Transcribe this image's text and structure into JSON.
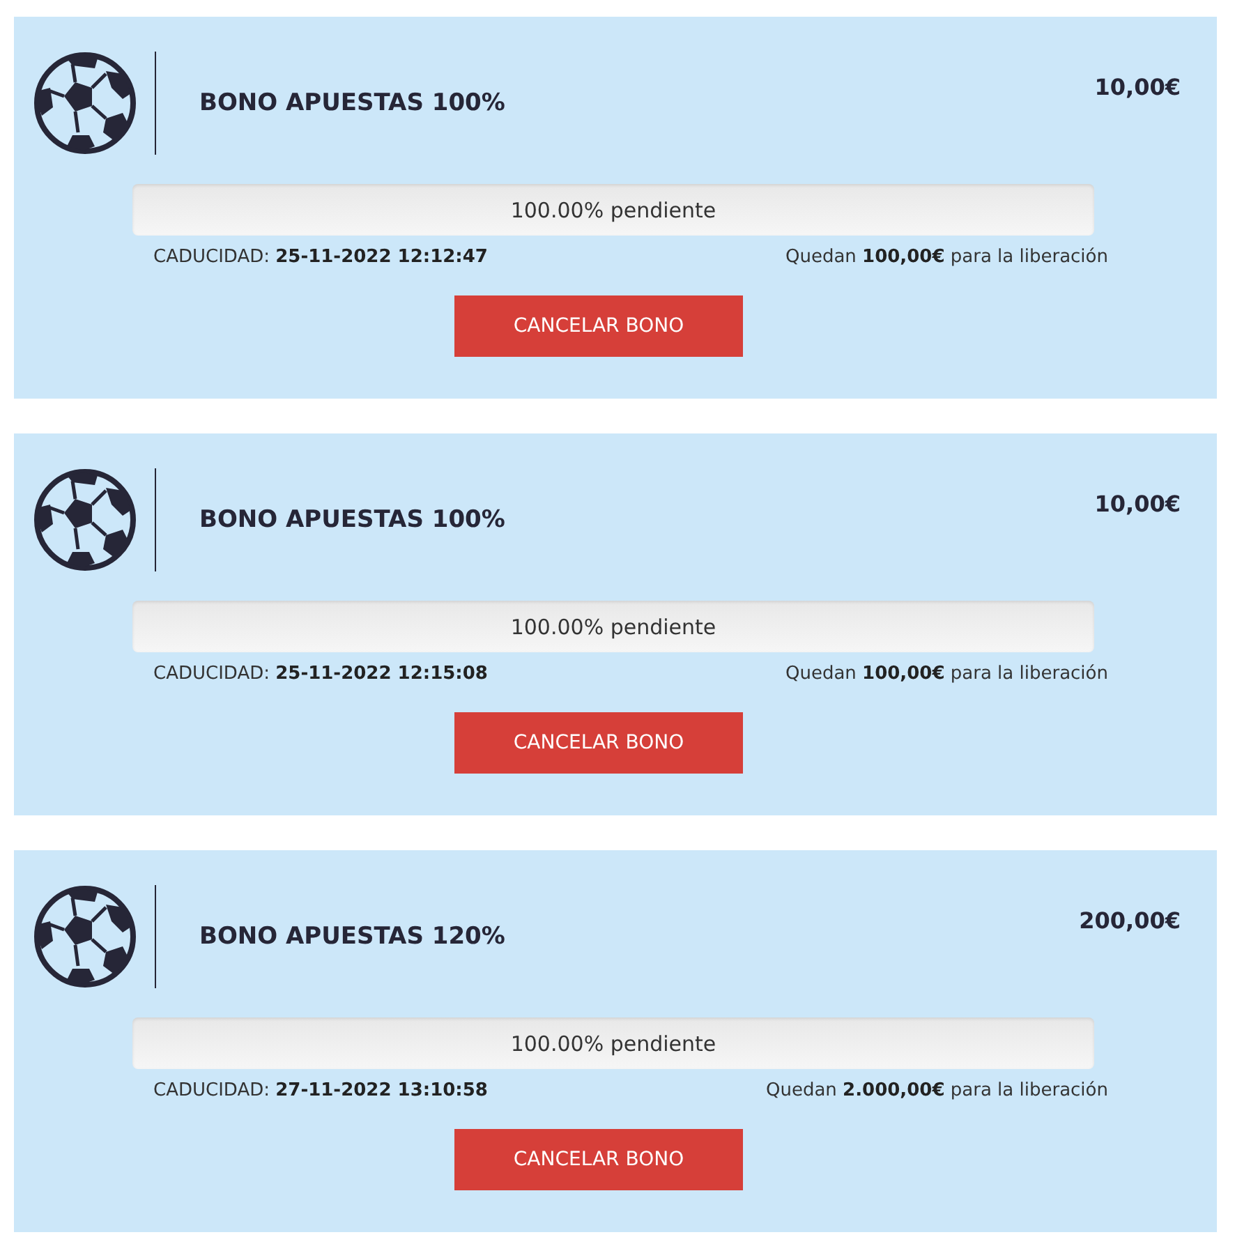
{
  "bonuses": [
    {
      "title": "BONO APUESTAS 100%",
      "amount": "10,00€",
      "progress": {
        "label": "100.00% pendiente"
      },
      "expiry": "CADUCIDAD: **25-11-2022 12:12:47**",
      "remaining": "Quedan **100,00€** para la liberación",
      "button": "CANCELAR BONO"
    },
    {
      "title": "BONO APUESTAS 100%",
      "amount": "10,00€",
      "progress": {
        "label": "100.00% pendiente"
      },
      "expiry": "CADUCIDAD: **25-11-2022 12:15:08**",
      "remaining": "Quedan **100,00€** para la liberación",
      "button": "CANCELAR BONO"
    },
    {
      "title": "BONO APUESTAS 120%",
      "amount": "200,00€",
      "progress": {
        "label": "100.00% pendiente"
      },
      "expiry": "CADUCIDAD: **27-11-2022 13:10:58**",
      "remaining": "Quedan **2.000,00€** para la liberación",
      "button": "CANCELAR BONO"
    }
  ]
}
